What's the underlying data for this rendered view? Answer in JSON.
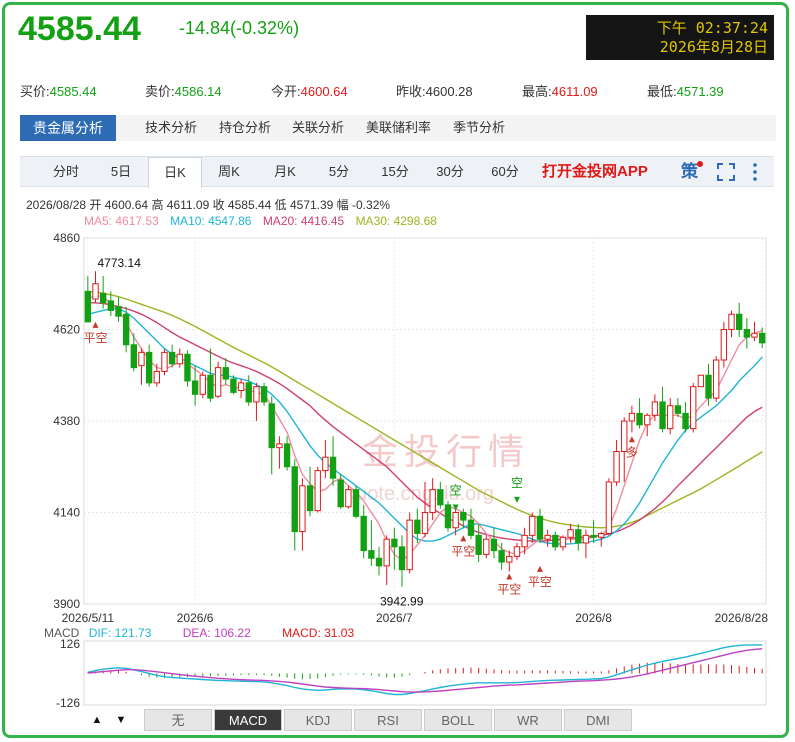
{
  "header": {
    "price": "4585.44",
    "change": "-14.84(-0.32%)",
    "clock_time": "下午 02:37:24",
    "clock_date": "2026年8月28日"
  },
  "quote": {
    "bid_label": "买价:",
    "bid": "4585.44",
    "ask_label": "卖价:",
    "ask": "4586.14",
    "open_label": "今开:",
    "open": "4600.64",
    "prev_label": "昨收:",
    "prev": "4600.28",
    "high_label": "最高:",
    "high": "4611.09",
    "low_label": "最低:",
    "low": "4571.39"
  },
  "nav": {
    "tabs": [
      "贵金属分析",
      "技术分析",
      "持仓分析",
      "关联分析",
      "美联储利率",
      "季节分析"
    ]
  },
  "periods": [
    "分时",
    "5日",
    "日K",
    "周K",
    "月K",
    "5分",
    "15分",
    "30分",
    "60分"
  ],
  "app_link": "打开金投网APP",
  "icons": {
    "calc": "策",
    "fullscreen": "fullscreen-icon",
    "more": "more-vertical-icon"
  },
  "ohlc_text": "2026/08/28  开 4600.64  高 4611.09  收 4585.44  低 4571.39  幅 -0.32%",
  "ma_legend": {
    "ma5": "MA5: 4617.53",
    "ma10": "MA10: 4547.86",
    "ma20": "MA20: 4416.45",
    "ma30": "MA30: 4298.68"
  },
  "colors": {
    "up": "#e01919",
    "down": "#13a113",
    "ma5": "#f08ca0",
    "ma10": "#1fb5d6",
    "ma20": "#d0406e",
    "ma30": "#9cb520",
    "accent": "#2d6bb5",
    "frame": "#35b34a"
  },
  "watermark": {
    "text": "金投行情",
    "url": "quote.cngold.org"
  },
  "chart_data": [
    {
      "type": "candlestick",
      "ylim": [
        3900,
        4860
      ],
      "y_ticks": [
        "4860",
        "4620",
        "4380",
        "4140",
        "3900"
      ],
      "x_labels": [
        "2026/5/11",
        "2026/6",
        "2026/7",
        "2026/8",
        "2026/8/28"
      ],
      "annotations": {
        "high_label": "4773.14",
        "low_label": "3942.99"
      },
      "signals": [
        "平空",
        "空",
        "平空",
        "空",
        "平空",
        "平空",
        "多"
      ],
      "candles": [
        [
          4720,
          4760,
          4640,
          4640
        ],
        [
          4700,
          4773,
          4690,
          4740
        ],
        [
          4715,
          4760,
          4675,
          4690
        ],
        [
          4695,
          4720,
          4655,
          4670
        ],
        [
          4680,
          4705,
          4640,
          4655
        ],
        [
          4660,
          4680,
          4560,
          4580
        ],
        [
          4580,
          4610,
          4510,
          4520
        ],
        [
          4525,
          4570,
          4475,
          4560
        ],
        [
          4560,
          4580,
          4470,
          4480
        ],
        [
          4480,
          4530,
          4470,
          4510
        ],
        [
          4510,
          4570,
          4500,
          4560
        ],
        [
          4560,
          4580,
          4520,
          4530
        ],
        [
          4530,
          4570,
          4520,
          4555
        ],
        [
          4555,
          4565,
          4470,
          4485
        ],
        [
          4485,
          4525,
          4420,
          4450
        ],
        [
          4450,
          4510,
          4440,
          4500
        ],
        [
          4500,
          4570,
          4430,
          4440
        ],
        [
          4445,
          4535,
          4440,
          4520
        ],
        [
          4520,
          4545,
          4475,
          4490
        ],
        [
          4490,
          4500,
          4450,
          4455
        ],
        [
          4460,
          4490,
          4440,
          4480
        ],
        [
          4480,
          4500,
          4420,
          4430
        ],
        [
          4430,
          4480,
          4380,
          4470
        ],
        [
          4470,
          4480,
          4420,
          4430
        ],
        [
          4425,
          4445,
          4240,
          4310
        ],
        [
          4310,
          4340,
          4255,
          4320
        ],
        [
          4320,
          4340,
          4250,
          4260
        ],
        [
          4260,
          4280,
          4040,
          4090
        ],
        [
          4090,
          4230,
          4040,
          4210
        ],
        [
          4210,
          4260,
          4130,
          4145
        ],
        [
          4145,
          4260,
          4140,
          4250
        ],
        [
          4250,
          4330,
          4230,
          4285
        ],
        [
          4285,
          4340,
          4210,
          4230
        ],
        [
          4225,
          4240,
          4150,
          4155
        ],
        [
          4155,
          4210,
          4150,
          4200
        ],
        [
          4200,
          4210,
          4125,
          4130
        ],
        [
          4130,
          4160,
          4020,
          4040
        ],
        [
          4040,
          4120,
          4000,
          4020
        ],
        [
          4020,
          4050,
          3975,
          4000
        ],
        [
          4000,
          4080,
          3950,
          4070
        ],
        [
          4070,
          4100,
          3990,
          4050
        ],
        [
          4050,
          4080,
          3945,
          3990
        ],
        [
          3990,
          4140,
          3980,
          4120
        ],
        [
          4120,
          4150,
          4060,
          4085
        ],
        [
          4085,
          4220,
          4075,
          4140
        ],
        [
          4140,
          4230,
          4120,
          4200
        ],
        [
          4200,
          4220,
          4150,
          4160
        ],
        [
          4160,
          4170,
          4090,
          4100
        ],
        [
          4100,
          4150,
          4080,
          4140
        ],
        [
          4140,
          4150,
          4100,
          4120
        ],
        [
          4120,
          4150,
          4070,
          4080
        ],
        [
          4080,
          4110,
          4010,
          4030
        ],
        [
          4030,
          4080,
          4020,
          4070
        ],
        [
          4070,
          4100,
          4020,
          4040
        ],
        [
          4040,
          4060,
          3990,
          4010
        ],
        [
          4010,
          4040,
          3985,
          4025
        ],
        [
          4025,
          4060,
          4015,
          4050
        ],
        [
          4050,
          4100,
          4030,
          4080
        ],
        [
          4080,
          4140,
          4060,
          4130
        ],
        [
          4130,
          4150,
          4060,
          4070
        ],
        [
          4070,
          4095,
          4050,
          4080
        ],
        [
          4080,
          4090,
          4040,
          4050
        ],
        [
          4050,
          4080,
          4040,
          4075
        ],
        [
          4075,
          4110,
          4060,
          4095
        ],
        [
          4095,
          4110,
          4040,
          4060
        ],
        [
          4060,
          4095,
          4020,
          4080
        ],
        [
          4080,
          4120,
          4060,
          4075
        ],
        [
          4075,
          4090,
          4050,
          4085
        ],
        [
          4085,
          4230,
          4080,
          4220
        ],
        [
          4220,
          4330,
          4210,
          4300
        ],
        [
          4300,
          4390,
          4220,
          4380
        ],
        [
          4380,
          4420,
          4350,
          4400
        ],
        [
          4400,
          4440,
          4360,
          4370
        ],
        [
          4370,
          4400,
          4340,
          4395
        ],
        [
          4395,
          4450,
          4380,
          4430
        ],
        [
          4430,
          4470,
          4350,
          4360
        ],
        [
          4360,
          4440,
          4345,
          4420
        ],
        [
          4420,
          4440,
          4390,
          4400
        ],
        [
          4400,
          4430,
          4350,
          4360
        ],
        [
          4360,
          4480,
          4350,
          4470
        ],
        [
          4470,
          4490,
          4470,
          4500
        ],
        [
          4500,
          4530,
          4420,
          4440
        ],
        [
          4440,
          4550,
          4430,
          4540
        ],
        [
          4540,
          4640,
          4520,
          4620
        ],
        [
          4620,
          4670,
          4600,
          4660
        ],
        [
          4660,
          4690,
          4600,
          4620
        ],
        [
          4620,
          4650,
          4570,
          4600
        ],
        [
          4600,
          4640,
          4590,
          4610
        ],
        [
          4610,
          4625,
          4571,
          4585
        ]
      ],
      "ma5": [
        4700,
        4710,
        4705,
        4690,
        4670,
        4640,
        4600,
        4570,
        4540,
        4520,
        4515,
        4525,
        4535,
        4530,
        4515,
        4500,
        4480,
        4470,
        4475,
        4470,
        4465,
        4460,
        4455,
        4450,
        4420,
        4385,
        4350,
        4290,
        4240,
        4215,
        4195,
        4200,
        4220,
        4230,
        4210,
        4195,
        4170,
        4140,
        4110,
        4065,
        4030,
        4015,
        4030,
        4055,
        4080,
        4110,
        4140,
        4155,
        4150,
        4140,
        4130,
        4110,
        4085,
        4065,
        4045,
        4035,
        4030,
        4040,
        4055,
        4070,
        4075,
        4080,
        4075,
        4070,
        4070,
        4070,
        4075,
        4080,
        4100,
        4150,
        4210,
        4270,
        4330,
        4375,
        4395,
        4395,
        4395,
        4395,
        4385,
        4395,
        4420,
        4440,
        4460,
        4500,
        4540,
        4580,
        4600,
        4610,
        4617
      ],
      "ma10": [
        4660,
        4665,
        4670,
        4675,
        4675,
        4665,
        4650,
        4630,
        4610,
        4590,
        4570,
        4555,
        4545,
        4535,
        4525,
        4515,
        4505,
        4500,
        4500,
        4495,
        4490,
        4485,
        4475,
        4465,
        4450,
        4430,
        4405,
        4375,
        4345,
        4315,
        4290,
        4270,
        4255,
        4240,
        4225,
        4210,
        4195,
        4180,
        4165,
        4145,
        4125,
        4105,
        4085,
        4070,
        4065,
        4065,
        4070,
        4080,
        4090,
        4100,
        4110,
        4110,
        4105,
        4100,
        4095,
        4090,
        4085,
        4078,
        4070,
        4064,
        4060,
        4058,
        4057,
        4058,
        4060,
        4062,
        4065,
        4070,
        4078,
        4092,
        4110,
        4135,
        4165,
        4200,
        4235,
        4270,
        4300,
        4330,
        4355,
        4375,
        4390,
        4405,
        4420,
        4440,
        4460,
        4485,
        4505,
        4525,
        4548
      ],
      "ma20": [
        4690,
        4690,
        4688,
        4685,
        4680,
        4675,
        4668,
        4660,
        4650,
        4638,
        4625,
        4612,
        4600,
        4590,
        4580,
        4570,
        4560,
        4550,
        4540,
        4532,
        4525,
        4518,
        4510,
        4500,
        4490,
        4478,
        4465,
        4450,
        4435,
        4420,
        4400,
        4382,
        4365,
        4350,
        4335,
        4320,
        4305,
        4290,
        4275,
        4260,
        4240,
        4220,
        4200,
        4180,
        4165,
        4150,
        4138,
        4125,
        4115,
        4105,
        4095,
        4088,
        4082,
        4077,
        4073,
        4070,
        4068,
        4066,
        4065,
        4065,
        4066,
        4068,
        4070,
        4072,
        4074,
        4076,
        4078,
        4080,
        4084,
        4090,
        4098,
        4108,
        4120,
        4135,
        4150,
        4168,
        4188,
        4210,
        4230,
        4250,
        4270,
        4290,
        4310,
        4330,
        4350,
        4370,
        4390,
        4405,
        4416
      ],
      "ma30": [
        4720,
        4718,
        4715,
        4711,
        4706,
        4700,
        4693,
        4686,
        4679,
        4672,
        4665,
        4657,
        4648,
        4638,
        4628,
        4617,
        4606,
        4595,
        4584,
        4573,
        4563,
        4553,
        4543,
        4533,
        4522,
        4510,
        4498,
        4486,
        4474,
        4462,
        4450,
        4438,
        4426,
        4414,
        4402,
        4390,
        4378,
        4366,
        4354,
        4342,
        4330,
        4318,
        4306,
        4294,
        4282,
        4270,
        4258,
        4246,
        4234,
        4222,
        4210,
        4198,
        4188,
        4178,
        4168,
        4158,
        4148,
        4140,
        4132,
        4125,
        4119,
        4114,
        4110,
        4107,
        4104,
        4102,
        4101,
        4100,
        4101,
        4104,
        4108,
        4114,
        4122,
        4132,
        4142,
        4152,
        4162,
        4172,
        4182,
        4192,
        4202,
        4214,
        4226,
        4238,
        4250,
        4262,
        4275,
        4287,
        4299
      ]
    },
    {
      "type": "macd",
      "ylim": [
        -126,
        126
      ],
      "y_ticks": [
        "126",
        "-126"
      ],
      "legend": {
        "label": "MACD",
        "dif": "DIF: 121.73",
        "dea": "DEA: 106.22",
        "macd": "MACD: 31.03"
      },
      "dif": [
        5,
        12,
        18,
        22,
        24,
        22,
        15,
        8,
        0,
        -8,
        -14,
        -18,
        -20,
        -22,
        -24,
        -26,
        -28,
        -30,
        -31,
        -32,
        -33,
        -34,
        -35,
        -36,
        -40,
        -46,
        -52,
        -60,
        -66,
        -70,
        -72,
        -71,
        -68,
        -66,
        -66,
        -67,
        -70,
        -74,
        -80,
        -86,
        -90,
        -90,
        -86,
        -80,
        -74,
        -66,
        -60,
        -54,
        -50,
        -46,
        -42,
        -40,
        -40,
        -40,
        -40,
        -40,
        -39,
        -37,
        -34,
        -32,
        -30,
        -29,
        -28,
        -27,
        -26,
        -25,
        -24,
        -22,
        -16,
        -6,
        5,
        16,
        26,
        36,
        44,
        52,
        58,
        64,
        70,
        78,
        86,
        94,
        102,
        110,
        116,
        120,
        122,
        122,
        122
      ],
      "dea": [
        2,
        5,
        8,
        11,
        14,
        16,
        16,
        14,
        11,
        7,
        3,
        -1,
        -5,
        -9,
        -12,
        -15,
        -18,
        -21,
        -23,
        -25,
        -27,
        -28,
        -29,
        -30,
        -32,
        -34,
        -37,
        -41,
        -45,
        -50,
        -54,
        -58,
        -60,
        -62,
        -63,
        -64,
        -65,
        -67,
        -69,
        -72,
        -75,
        -78,
        -80,
        -80,
        -79,
        -77,
        -75,
        -72,
        -69,
        -66,
        -63,
        -60,
        -57,
        -54,
        -52,
        -50,
        -49,
        -47,
        -45,
        -43,
        -41,
        -39,
        -37,
        -35,
        -33,
        -32,
        -31,
        -29,
        -27,
        -24,
        -20,
        -15,
        -9,
        -2,
        6,
        14,
        22,
        30,
        38,
        46,
        54,
        62,
        70,
        78,
        86,
        93,
        99,
        103,
        106
      ]
    }
  ],
  "macd_tabs": [
    "无",
    "MACD",
    "KDJ",
    "RSI",
    "BOLL",
    "WR",
    "DMI"
  ],
  "macd_active": "MACD"
}
